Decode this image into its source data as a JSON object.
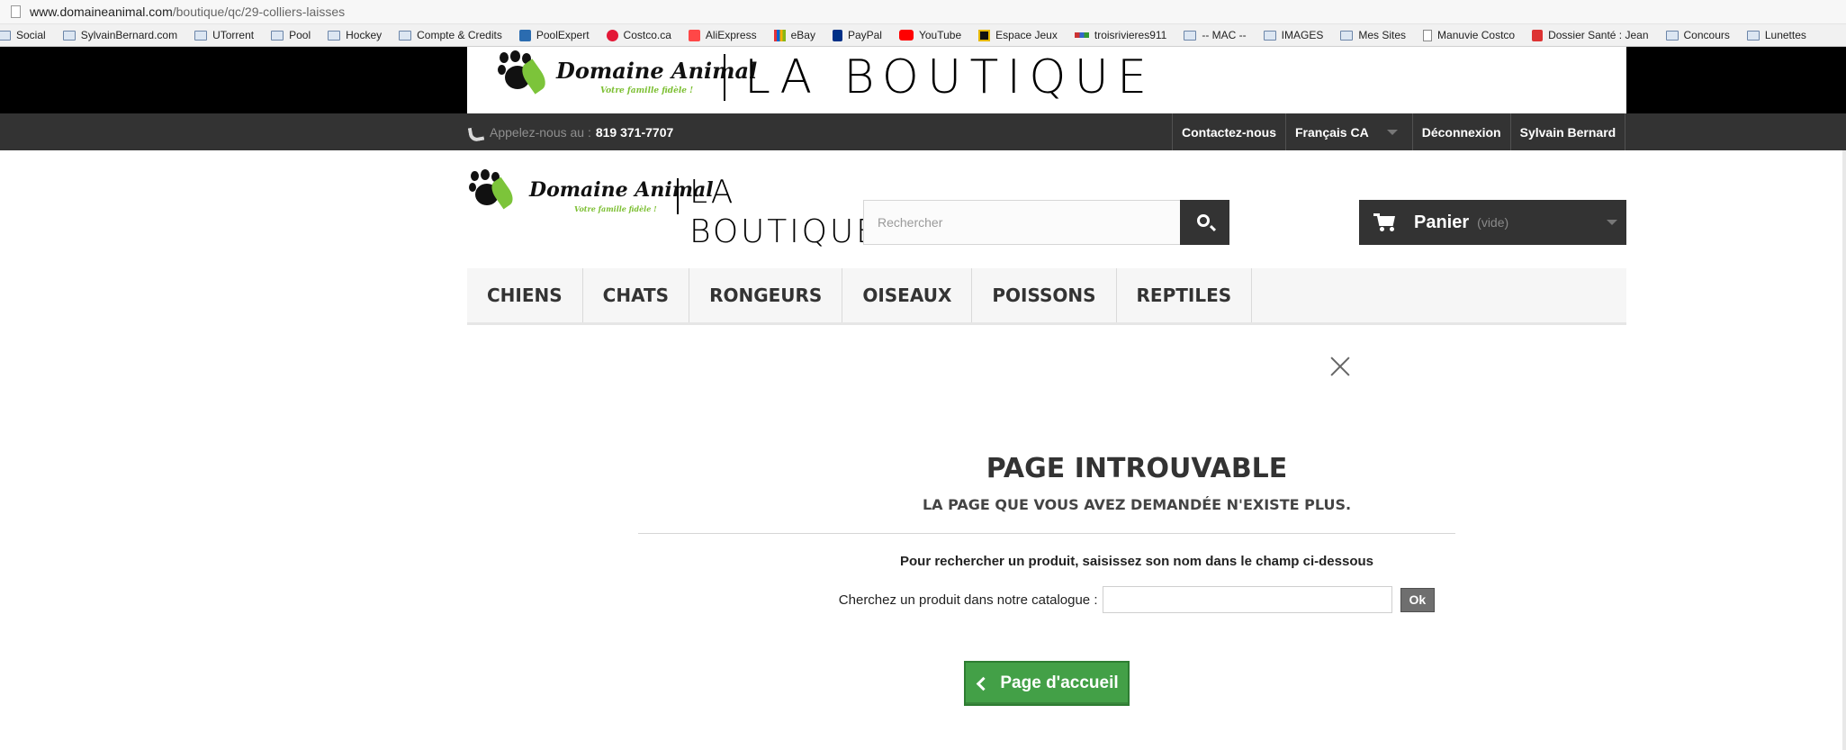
{
  "browser": {
    "url_host": "www.domaineanimal.com",
    "url_path": "/boutique/qc/29-colliers-laisses",
    "bookmarks": [
      {
        "label": "Social",
        "icon": "folder-icon"
      },
      {
        "label": "SylvainBernard.com",
        "icon": "folder-icon"
      },
      {
        "label": "UTorrent",
        "icon": "folder-icon"
      },
      {
        "label": "Pool",
        "icon": "folder-icon"
      },
      {
        "label": "Hockey",
        "icon": "folder-icon"
      },
      {
        "label": "Compte & Credits",
        "icon": "folder-icon"
      },
      {
        "label": "PoolExpert",
        "icon": "site-icon"
      },
      {
        "label": "Costco.ca",
        "icon": "costco-icon"
      },
      {
        "label": "AliExpress",
        "icon": "aliexpress-icon"
      },
      {
        "label": "eBay",
        "icon": "ebay-icon"
      },
      {
        "label": "PayPal",
        "icon": "paypal-icon"
      },
      {
        "label": "YouTube",
        "icon": "youtube-icon"
      },
      {
        "label": "Espace Jeux",
        "icon": "espace-jeux-icon"
      },
      {
        "label": "troisrivieres911",
        "icon": "troisrivieres-icon"
      },
      {
        "label": "-- MAC --",
        "icon": "folder-icon"
      },
      {
        "label": "IMAGES",
        "icon": "folder-icon"
      },
      {
        "label": "Mes Sites",
        "icon": "folder-icon"
      },
      {
        "label": "Manuvie Costco",
        "icon": "page-icon"
      },
      {
        "label": "Dossier Santé : Jean",
        "icon": "sante-icon"
      },
      {
        "label": "Concours",
        "icon": "folder-icon"
      },
      {
        "label": "Lunettes",
        "icon": "folder-icon"
      }
    ]
  },
  "banner": {
    "brand": "Domaine Animal",
    "tagline": "Votre famille fidèle !",
    "boutique": "LA BOUTIQUE"
  },
  "topnav": {
    "phone_prefix": "Appelez-nous au :",
    "phone_number": "819 371-7707",
    "contact": "Contactez-nous",
    "language": "Français CA",
    "logout": "Déconnexion",
    "user": "Sylvain Bernard"
  },
  "header": {
    "search_placeholder": "Rechercher",
    "cart_label": "Panier",
    "cart_status": "(vide)"
  },
  "categories": [
    "CHIENS",
    "CHATS",
    "RONGEURS",
    "OISEAUX",
    "POISSONS",
    "REPTILES"
  ],
  "error": {
    "title": "PAGE INTROUVABLE",
    "subtitle": "LA PAGE QUE VOUS AVEZ DEMANDÉE N'EXISTE PLUS.",
    "hint": "Pour rechercher un produit, saisissez son nom dans le champ ci-dessous",
    "search_label": "Cherchez un produit dans notre catalogue :",
    "ok_label": "Ok",
    "home_label": "Page d'accueil"
  },
  "colors": {
    "navbar": "#333333",
    "home_button": "#43a047",
    "leaf_green": "#7cc43a"
  }
}
